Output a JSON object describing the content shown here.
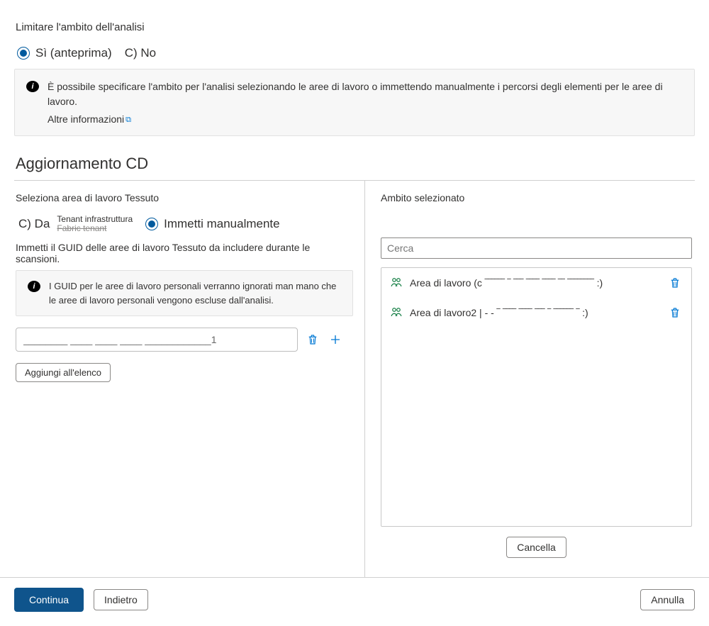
{
  "heading": "Limitare l'ambito dell'analisi",
  "radios_scope": {
    "yes": "Sì (anteprima)",
    "no": "C) No"
  },
  "info1": {
    "text": "È possibile specificare l'ambito per l'analisi selezionando le aree di lavoro o immettendo manualmente i percorsi degli elementi per le aree di lavoro.",
    "link": "Altre informazioni"
  },
  "section_title": "Aggiornamento CD",
  "left": {
    "sub_heading": "Seleziona area di lavoro Tessuto",
    "radio_da": "C) Da",
    "tenant": "Tenant infrastruttura",
    "tenant_strike": "Fabric tenant",
    "radio_manual": "Immetti manualmente",
    "desc": "Immetti il GUID delle aree di lavoro Tessuto da includere durante le scansioni.",
    "info2": "I GUID per le aree di lavoro personali verranno ignorati man mano che le aree di lavoro personali vengono escluse dall'analisi.",
    "guid_value": "________ ____ ____ ____ ____________1",
    "add_button": "Aggiungi all'elenco"
  },
  "right": {
    "sub_heading": "Ambito selezionato",
    "search_placeholder": "Cerca",
    "items": [
      "Area di lavoro (c  ‾‾‾‾‾‾  ‾  ‾‾‾  ‾‾‾‾  ‾‾‾‾  ‾‾  ‾‾‾‾‾‾‾‾  :)",
      "Area di lavoro2 |  - -     ‾  ‾‾‾‾  ‾‾‾‾  ‾‾‾  ‾   ‾‾‾‾‾‾  ‾  :)"
    ],
    "clear": "Cancella"
  },
  "footer": {
    "continue": "Continua",
    "back": "Indietro",
    "cancel": "Annulla"
  }
}
